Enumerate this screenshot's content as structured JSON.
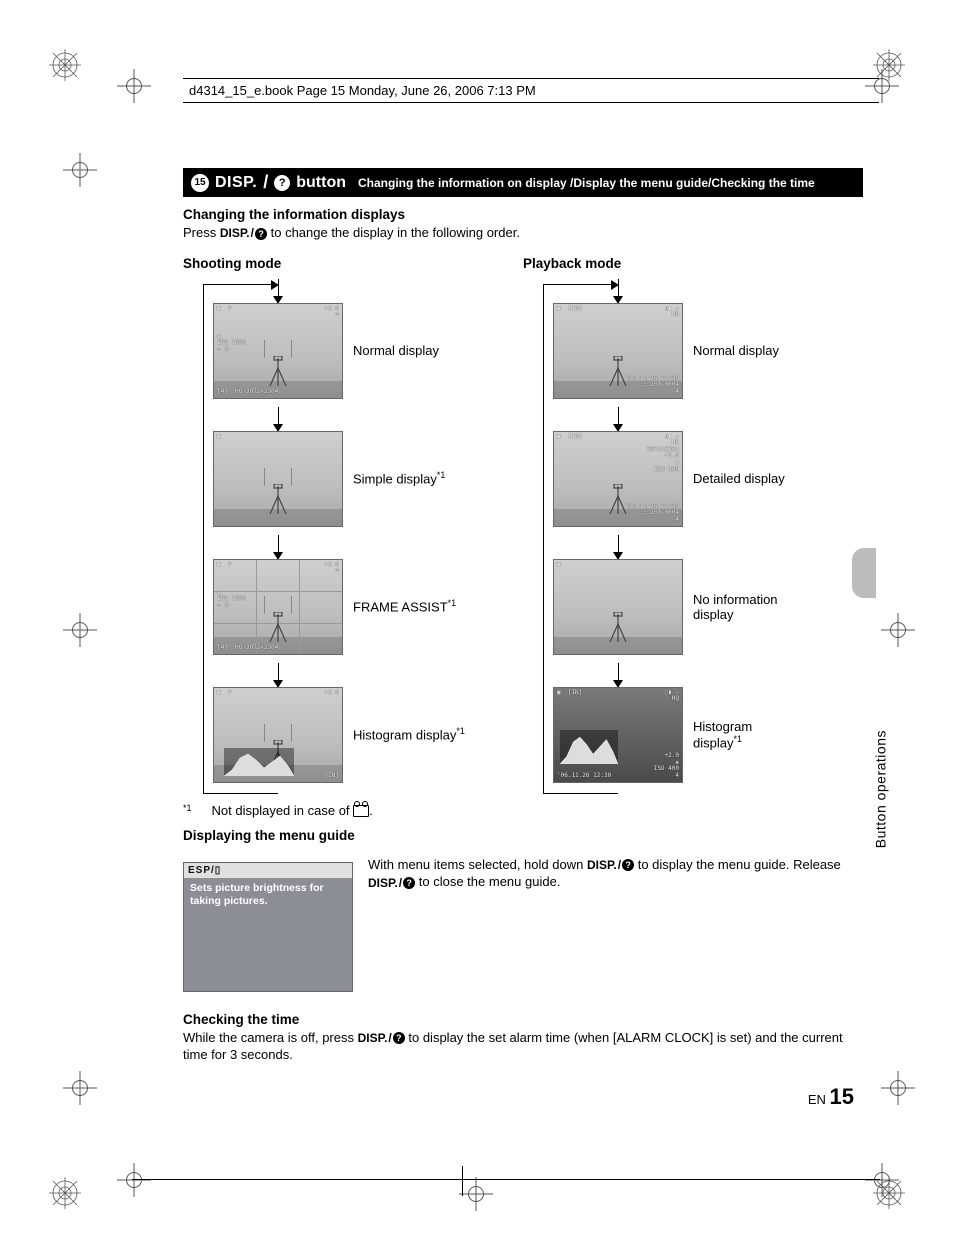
{
  "header_stamp": "d4314_15_e.book  Page 15  Monday, June 26, 2006  7:13 PM",
  "bar": {
    "number": "15",
    "disp": "DISP.",
    "button": "button",
    "desc": "Changing the information on display /Display the menu guide/Checking the time"
  },
  "s1": {
    "title": "Changing the information displays",
    "press_a": "Press ",
    "press_b": " to change the display in the following order."
  },
  "modes": {
    "shoot": "Shooting mode",
    "play": "Playback mode"
  },
  "shoot_items": [
    {
      "label": "Normal display",
      "osd_tl": "▣  P",
      "osd_tr": "+2.0\n⊘",
      "osd_ml": "❀\nISO 1600\n▭ ⏲",
      "osd_bl": "[4]  HQ 3072×2304"
    },
    {
      "label": "Simple display",
      "sup": "*1",
      "osd_tl": "▣"
    },
    {
      "label": "FRAME ASSIST",
      "sup": "*1",
      "grid": true,
      "osd_tl": "▣  P",
      "osd_tr": "+2.0\n⊘",
      "osd_ml": "❀\nISO 1600\n▭ ⏲",
      "osd_bl": "[4]  HQ 3072×2304"
    },
    {
      "label": "Histogram display",
      "sup": "*1",
      "histo": true,
      "osd_tl": "▣  P",
      "osd_tr": "+2.0",
      "osd_br": "[IN]"
    }
  ],
  "play_items": [
    {
      "label": "Normal display",
      "osd_tl": "▣  [IN]",
      "osd_tr": "▯▮ ☆\nHQ",
      "osd_br": "'06.11.26 12:30\n▭ 100-0004\n4"
    },
    {
      "label": "Detailed display",
      "osd_tl": "▣  [IN]",
      "osd_tr": "▯▮ ☆\nHQ\n3072×2304\n+2.0\n❀\nISO 400",
      "osd_br": "'06.11.26 12:30\n▭ 100-0004\n4"
    },
    {
      "label": "No information display",
      "plain": true,
      "osd_tl": "▣"
    },
    {
      "label_a": "Histogram",
      "label_b": "display",
      "sup": "*1",
      "dark": true,
      "histo": true,
      "osd_tl": "▣  [IN]",
      "osd_tr": "▯▮ ☆\nHQ",
      "osd_br": "+2.0\n❀\nISO 400\n4",
      "osd_bl": "'06.11.26 12:30"
    }
  ],
  "footnote": "Not displayed in case of ",
  "footnote_pre": "*1",
  "s2": {
    "title": "Displaying the menu guide",
    "box_top": "ESP/▯",
    "box_blurb": "Sets picture brightness for taking pictures.",
    "text_a": "With menu items selected, hold down ",
    "text_b": " to display the menu guide. Release ",
    "text_c": " to close the menu guide."
  },
  "s3": {
    "title": "Checking the time",
    "text_a": "While the camera is off, press ",
    "text_b": " to display the set alarm time (when [ALARM CLOCK] is set) and the current time for 3 seconds."
  },
  "side_label": "Button operations",
  "page_number": {
    "lang": "EN",
    "num": "15"
  }
}
